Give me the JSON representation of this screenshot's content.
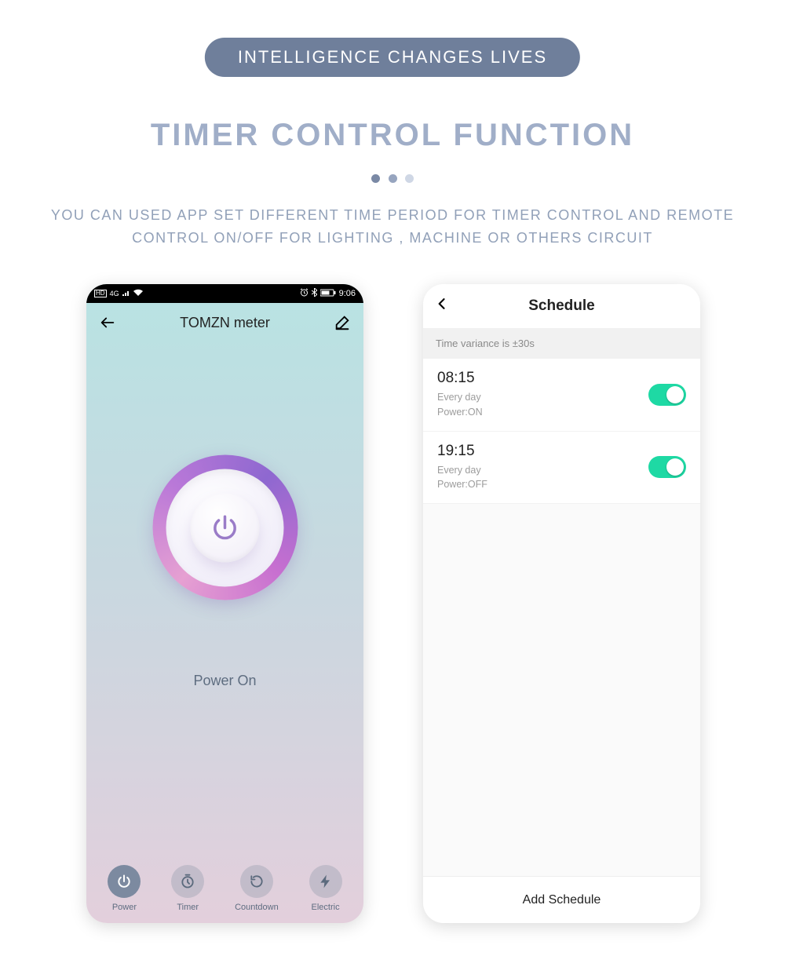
{
  "marketing": {
    "pill": "INTELLIGENCE CHANGES LIVES",
    "title": "TIMER CONTROL FUNCTION",
    "subtitle": "YOU CAN USED APP SET DIFFERENT TIME PERIOD FOR TIMER CONTROL AND REMOTE CONTROL ON/OFF FOR LIGHTING , MACHINE OR OTHERS CIRCUIT",
    "dot_colors": [
      "#7a89a5",
      "#97a5bf",
      "#cfd7e5"
    ]
  },
  "phone_power": {
    "status_time": "9:06",
    "device_name": "TOMZN meter",
    "power_status": "Power On",
    "tabs": [
      {
        "label": "Power",
        "icon": "power",
        "active": true
      },
      {
        "label": "Timer",
        "icon": "timer",
        "active": false
      },
      {
        "label": "Countdown",
        "icon": "countdown",
        "active": false
      },
      {
        "label": "Electric",
        "icon": "bolt",
        "active": false
      }
    ]
  },
  "phone_schedule": {
    "title": "Schedule",
    "variance_note": "Time variance is ±30s",
    "add_button": "Add Schedule",
    "items": [
      {
        "time": "08:15",
        "repeat": "Every day",
        "power": "Power:ON",
        "enabled": true
      },
      {
        "time": "19:15",
        "repeat": "Every day",
        "power": "Power:OFF",
        "enabled": true
      }
    ]
  },
  "colors": {
    "accent_toggle": "#1ed9a4",
    "pill_bg": "#6f7f9b",
    "title_color": "#a0aec8"
  }
}
